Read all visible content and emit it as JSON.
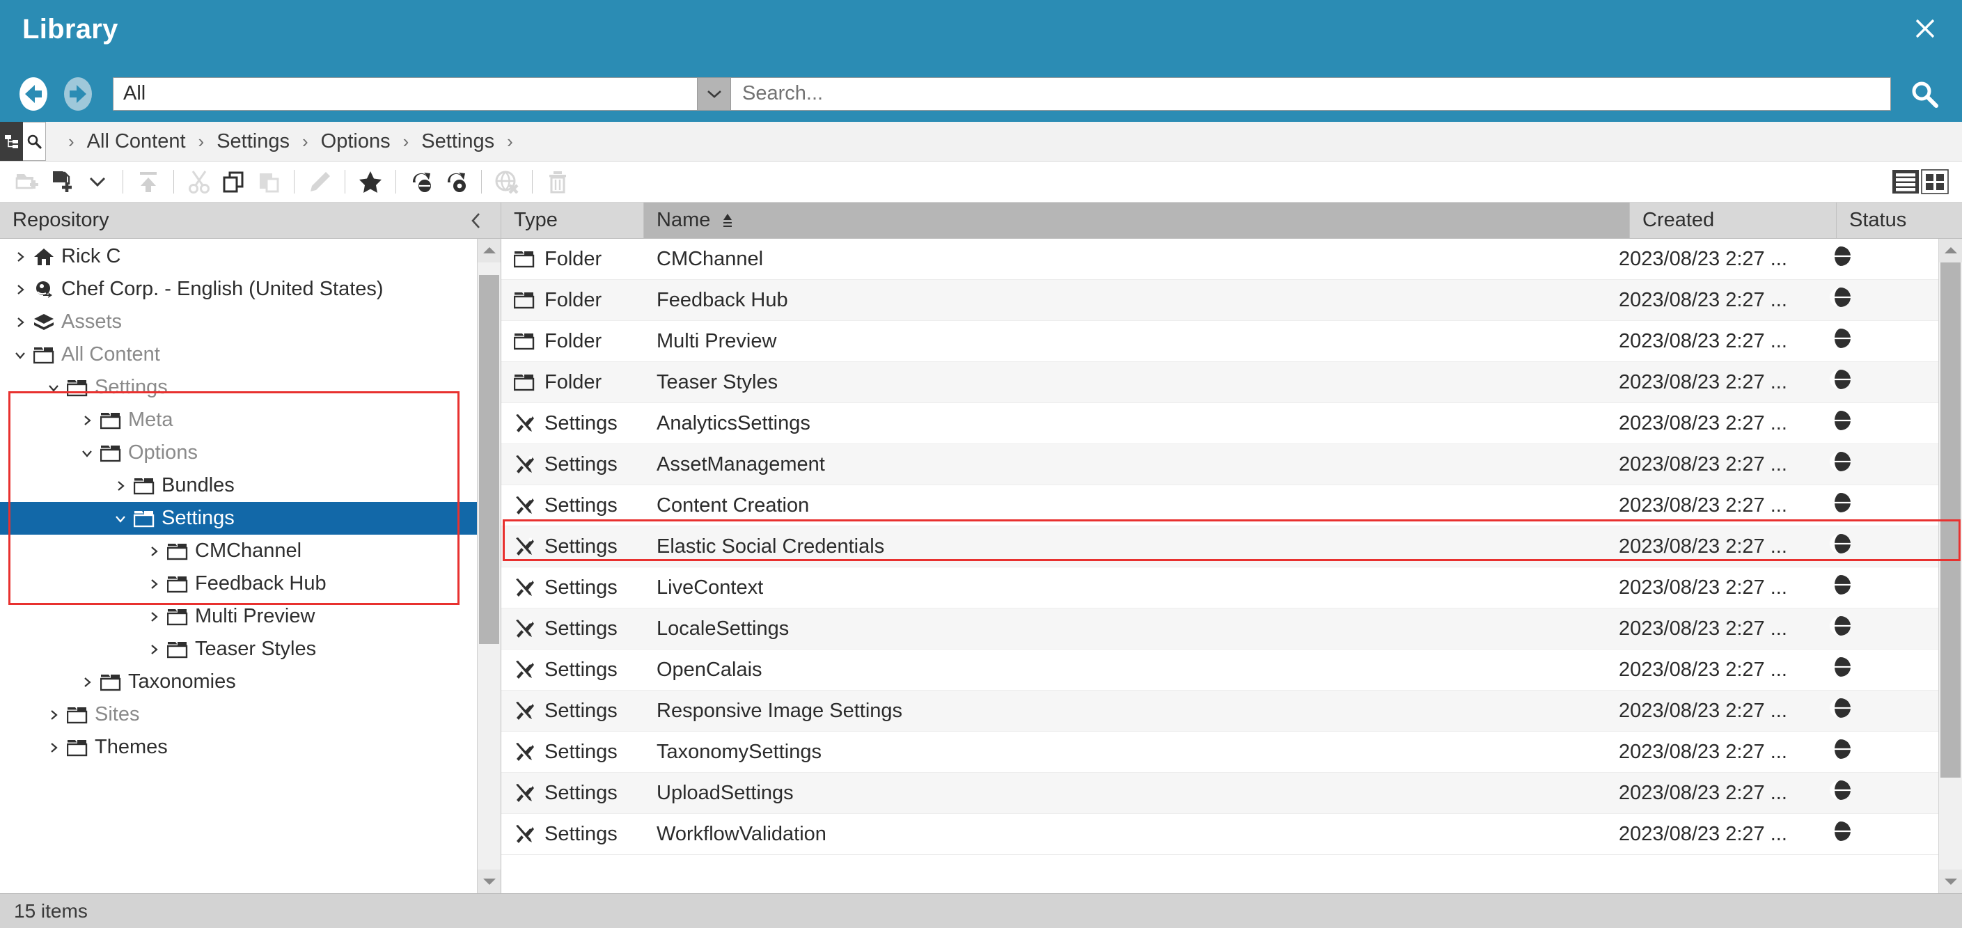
{
  "window": {
    "title": "Library",
    "close_label": "×"
  },
  "nav": {
    "back_label": "Back",
    "forward_label": "Forward",
    "filter_value": "All",
    "filter_caret": "⌄",
    "search_placeholder": "Search...",
    "search_value": "",
    "search_button_label": "Search"
  },
  "breadcrumb": {
    "tree_toggle_label": "Tree view",
    "search_toggle_label": "Search view",
    "separator": "›",
    "items": [
      {
        "label": "All Content"
      },
      {
        "label": "Settings"
      },
      {
        "label": "Options"
      },
      {
        "label": "Settings"
      }
    ]
  },
  "toolbar": {
    "buttons": [
      {
        "name": "new-folder-button",
        "label": "New Folder",
        "enabled": false
      },
      {
        "name": "new-content-button",
        "label": "New Content",
        "enabled": true
      },
      {
        "name": "new-content-dropdown",
        "label": "More",
        "enabled": true
      },
      {
        "name": "upload-button",
        "label": "Upload",
        "enabled": false
      },
      {
        "name": "cut-button",
        "label": "Cut",
        "enabled": false
      },
      {
        "name": "copy-button",
        "label": "Copy",
        "enabled": true
      },
      {
        "name": "paste-button",
        "label": "Paste",
        "enabled": false
      },
      {
        "name": "edit-button",
        "label": "Edit",
        "enabled": false
      },
      {
        "name": "favorite-button",
        "label": "Favorite",
        "enabled": true
      },
      {
        "name": "publish-button",
        "label": "Publish",
        "enabled": true
      },
      {
        "name": "approve-publish-button",
        "label": "Approve and Publish",
        "enabled": true
      },
      {
        "name": "withdraw-button",
        "label": "Withdraw",
        "enabled": false
      },
      {
        "name": "delete-button",
        "label": "Delete",
        "enabled": false
      }
    ],
    "view_list_label": "List view",
    "view_thumb_label": "Thumbnail view"
  },
  "tree": {
    "header_title": "Repository",
    "collapse_label": "‹",
    "nodes": [
      {
        "label": "Rick C",
        "icon": "home-icon",
        "indent": 0,
        "expander": "collapsed",
        "muted": false,
        "selected": false
      },
      {
        "label": "Chef Corp. - English (United States)",
        "icon": "site-icon",
        "indent": 0,
        "expander": "collapsed",
        "muted": false,
        "selected": false
      },
      {
        "label": "Assets",
        "icon": "assets-icon",
        "indent": 0,
        "expander": "collapsed",
        "muted": true,
        "selected": false
      },
      {
        "label": "All Content",
        "icon": "folder-icon",
        "indent": 0,
        "expander": "expanded",
        "muted": true,
        "selected": false
      },
      {
        "label": "Settings",
        "icon": "folder-icon",
        "indent": 1,
        "expander": "expanded",
        "muted": true,
        "selected": false
      },
      {
        "label": "Meta",
        "icon": "folder-icon",
        "indent": 2,
        "expander": "collapsed",
        "muted": true,
        "selected": false
      },
      {
        "label": "Options",
        "icon": "folder-icon",
        "indent": 2,
        "expander": "expanded",
        "muted": true,
        "selected": false
      },
      {
        "label": "Bundles",
        "icon": "folder-icon",
        "indent": 3,
        "expander": "collapsed",
        "muted": false,
        "selected": false
      },
      {
        "label": "Settings",
        "icon": "folder-icon",
        "indent": 3,
        "expander": "expanded",
        "muted": false,
        "selected": true
      },
      {
        "label": "CMChannel",
        "icon": "folder-icon",
        "indent": 4,
        "expander": "collapsed",
        "muted": false,
        "selected": false
      },
      {
        "label": "Feedback Hub",
        "icon": "folder-icon",
        "indent": 4,
        "expander": "collapsed",
        "muted": false,
        "selected": false
      },
      {
        "label": "Multi Preview",
        "icon": "folder-icon",
        "indent": 4,
        "expander": "collapsed",
        "muted": false,
        "selected": false
      },
      {
        "label": "Teaser Styles",
        "icon": "folder-icon",
        "indent": 4,
        "expander": "collapsed",
        "muted": false,
        "selected": false
      },
      {
        "label": "Taxonomies",
        "icon": "folder-icon",
        "indent": 2,
        "expander": "collapsed",
        "muted": false,
        "selected": false
      },
      {
        "label": "Sites",
        "icon": "folder-icon",
        "indent": 1,
        "expander": "collapsed",
        "muted": true,
        "selected": false
      },
      {
        "label": "Themes",
        "icon": "folder-icon",
        "indent": 1,
        "expander": "collapsed",
        "muted": false,
        "selected": false
      }
    ]
  },
  "grid": {
    "columns": [
      {
        "key": "type",
        "label": "Type",
        "sorted": false
      },
      {
        "key": "name",
        "label": "Name",
        "sorted": true,
        "sort_dir": "asc"
      },
      {
        "key": "created",
        "label": "Created",
        "sorted": false
      },
      {
        "key": "status",
        "label": "Status",
        "sorted": false
      }
    ],
    "rows": [
      {
        "type": "Folder",
        "icon": "folder-icon",
        "name": "CMChannel",
        "created": "2023/08/23 2:27 ...",
        "status": "published-icon",
        "highlighted": false
      },
      {
        "type": "Folder",
        "icon": "folder-icon",
        "name": "Feedback Hub",
        "created": "2023/08/23 2:27 ...",
        "status": "published-icon",
        "highlighted": false
      },
      {
        "type": "Folder",
        "icon": "folder-icon",
        "name": "Multi Preview",
        "created": "2023/08/23 2:27 ...",
        "status": "published-icon",
        "highlighted": false
      },
      {
        "type": "Folder",
        "icon": "folder-icon",
        "name": "Teaser Styles",
        "created": "2023/08/23 2:27 ...",
        "status": "published-icon",
        "highlighted": false
      },
      {
        "type": "Settings",
        "icon": "settings-icon",
        "name": "AnalyticsSettings",
        "created": "2023/08/23 2:27 ...",
        "status": "published-icon",
        "highlighted": false
      },
      {
        "type": "Settings",
        "icon": "settings-icon",
        "name": "AssetManagement",
        "created": "2023/08/23 2:27 ...",
        "status": "published-icon",
        "highlighted": false
      },
      {
        "type": "Settings",
        "icon": "settings-icon",
        "name": "Content Creation",
        "created": "2023/08/23 2:27 ...",
        "status": "published-icon",
        "highlighted": true
      },
      {
        "type": "Settings",
        "icon": "settings-icon",
        "name": "Elastic Social Credentials",
        "created": "2023/08/23 2:27 ...",
        "status": "published-icon",
        "highlighted": false
      },
      {
        "type": "Settings",
        "icon": "settings-icon",
        "name": "LiveContext",
        "created": "2023/08/23 2:27 ...",
        "status": "published-icon",
        "highlighted": false
      },
      {
        "type": "Settings",
        "icon": "settings-icon",
        "name": "LocaleSettings",
        "created": "2023/08/23 2:27 ...",
        "status": "published-icon",
        "highlighted": false
      },
      {
        "type": "Settings",
        "icon": "settings-icon",
        "name": "OpenCalais",
        "created": "2023/08/23 2:27 ...",
        "status": "published-icon",
        "highlighted": false
      },
      {
        "type": "Settings",
        "icon": "settings-icon",
        "name": "Responsive Image Settings",
        "created": "2023/08/23 2:27 ...",
        "status": "published-icon",
        "highlighted": false
      },
      {
        "type": "Settings",
        "icon": "settings-icon",
        "name": "TaxonomySettings",
        "created": "2023/08/23 2:27 ...",
        "status": "published-icon",
        "highlighted": false
      },
      {
        "type": "Settings",
        "icon": "settings-icon",
        "name": "UploadSettings",
        "created": "2023/08/23 2:27 ...",
        "status": "published-icon",
        "highlighted": false
      },
      {
        "type": "Settings",
        "icon": "settings-icon",
        "name": "WorkflowValidation",
        "created": "2023/08/23 2:27 ...",
        "status": "published-icon",
        "highlighted": false
      }
    ]
  },
  "status_bar": {
    "items_text": "15 items"
  },
  "colors": {
    "header_teal": "#2b8cb4",
    "selection_blue": "#1268a8",
    "annotation_red": "#e8312f",
    "header_grey": "#d8d8d8",
    "sorted_col_grey": "#b6b6b6"
  }
}
